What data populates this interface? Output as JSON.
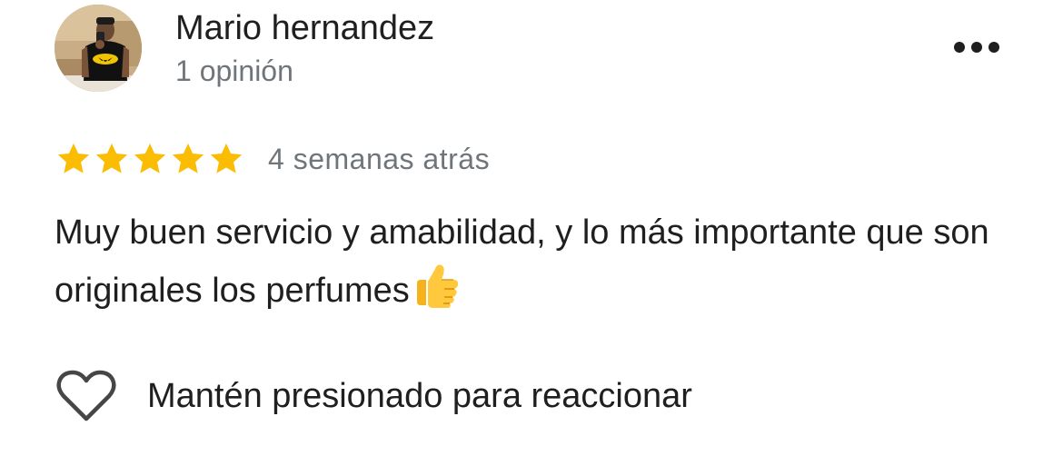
{
  "reviewer": {
    "name": "Mario hernandez",
    "review_count": "1 opinión",
    "avatar_icon": "user-photo"
  },
  "menu": {
    "icon": "more-horizontal-icon"
  },
  "review": {
    "rating": 5,
    "rating_max": 5,
    "star_color": "#fbbc04",
    "date": "4 semanas atrás",
    "text": "Muy buen servicio y amabilidad, y lo más importante que son originales los perfumes",
    "emoji": "thumbs-up-emoji"
  },
  "reaction": {
    "icon": "heart-outline-icon",
    "label": "Mantén presionado para reaccionar"
  }
}
